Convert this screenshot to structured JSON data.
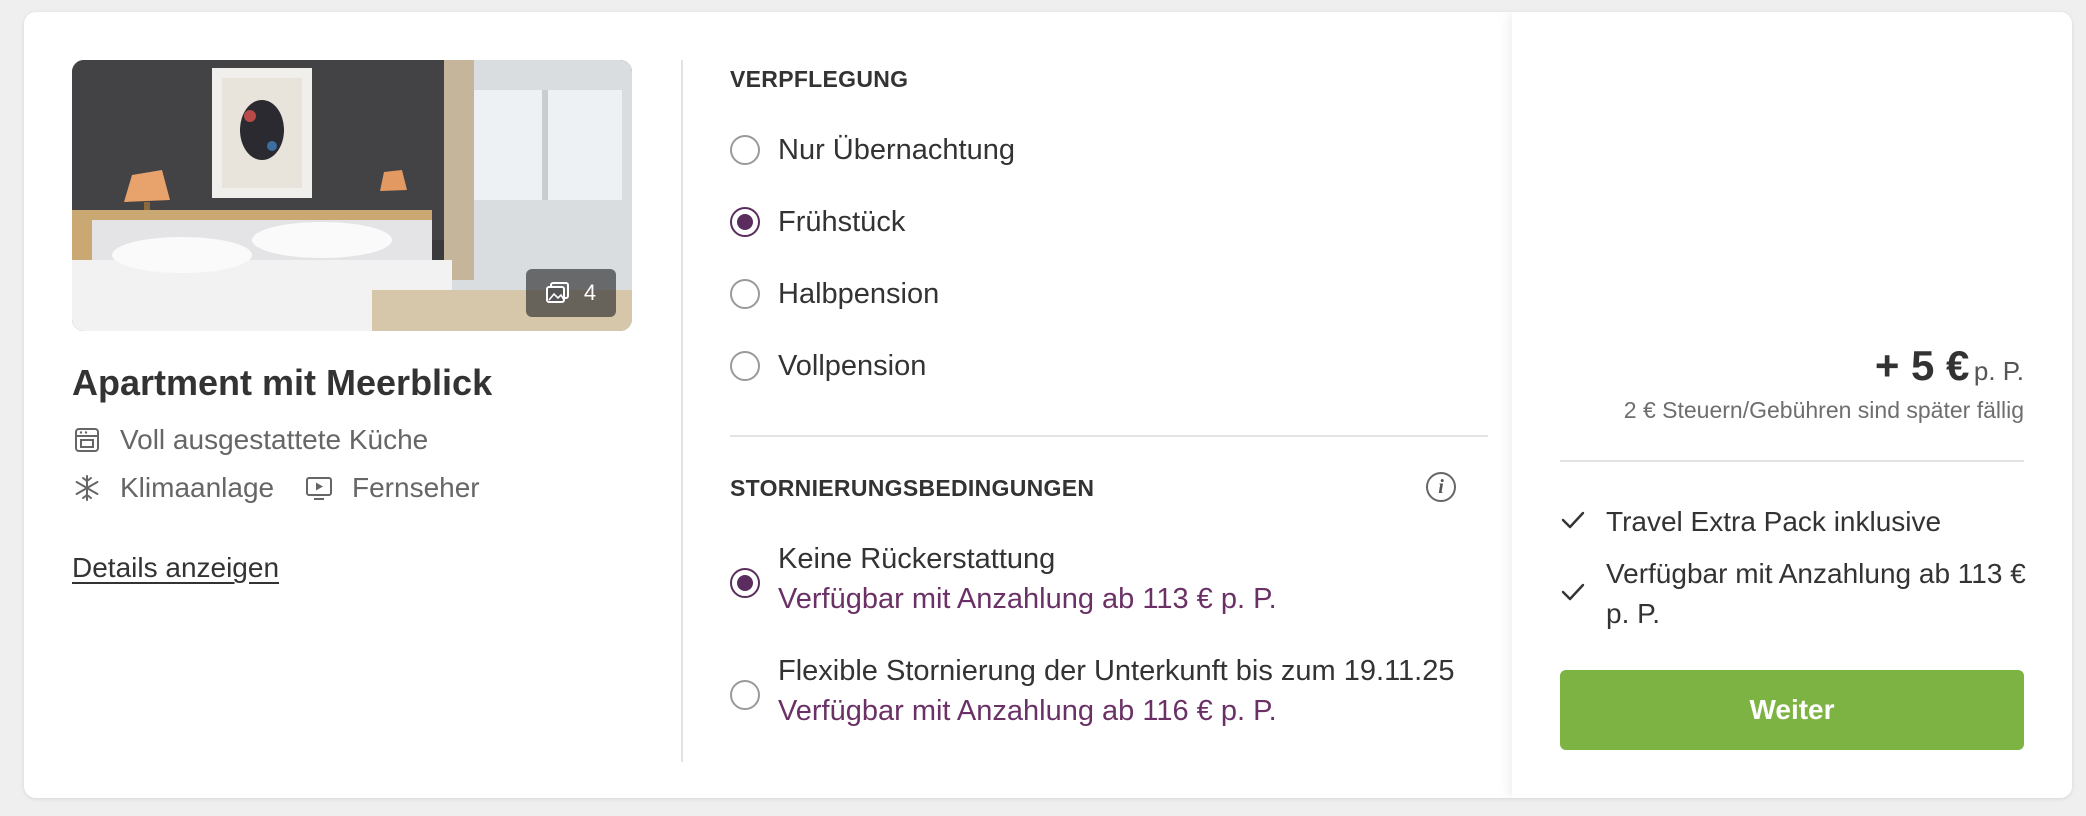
{
  "room": {
    "image_count": "4",
    "title": "Apartment mit Meerblick",
    "amenities": [
      {
        "label": "Voll ausgestattete Küche",
        "icon": "oven-icon"
      },
      {
        "label": "Klimaanlage",
        "icon": "snowflake-icon"
      },
      {
        "label": "Fernseher",
        "icon": "tv-icon"
      }
    ],
    "details_link": "Details anzeigen"
  },
  "meals": {
    "title": "VERPFLEGUNG",
    "selected": "Frühstück",
    "options": [
      {
        "label": "Nur Übernachtung"
      },
      {
        "label": "Frühstück"
      },
      {
        "label": "Halbpension"
      },
      {
        "label": "Vollpension"
      }
    ]
  },
  "cancellation": {
    "title": "STORNIERUNGSBEDINGUNGEN",
    "selected": "Keine Rückerstattung",
    "options": [
      {
        "label": "Keine Rückerstattung",
        "sub": "Verfügbar mit Anzahlung ab 113 € p. P."
      },
      {
        "label": "Flexible Stornierung der Unterkunft bis zum 19.11.25",
        "sub": "Verfügbar mit Anzahlung ab 116 € p. P."
      }
    ]
  },
  "summary": {
    "price": "+ 5 €",
    "price_unit": "p. P.",
    "tax_note": "2 € Steuern/Gebühren sind später fällig",
    "features": [
      "Travel Extra Pack inklusive",
      "Verfügbar mit Anzahlung ab 113 € p. P."
    ],
    "button": "Weiter"
  },
  "colors": {
    "accent": "#5a2d5e",
    "sub_text": "#6b3166",
    "button": "#7cb342"
  }
}
